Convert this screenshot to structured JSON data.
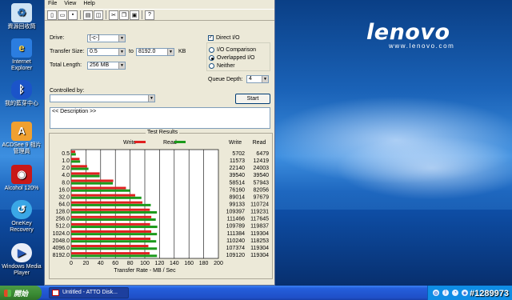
{
  "desktop": {
    "brand": "lenovo",
    "brand_url": "www.lenovo.com",
    "icons": [
      {
        "label": "資源回收筒",
        "icon": "recycle-bin-icon"
      },
      {
        "label": "Internet Explorer",
        "icon": "internet-explorer-icon"
      },
      {
        "label": "我的藍芽中心",
        "icon": "bluetooth-icon"
      },
      {
        "label": "ACDSee 9 相片管理員",
        "icon": "acdsee-icon"
      },
      {
        "label": "Alcohol 120%",
        "icon": "alcohol-icon"
      },
      {
        "label": "OneKey Recovery",
        "icon": "onekey-recovery-icon"
      },
      {
        "label": "Windows Media Player",
        "icon": "media-player-icon"
      }
    ]
  },
  "window": {
    "menu": [
      "File",
      "View",
      "Help"
    ],
    "drive_label": "Drive:",
    "drive_value": "[-c-]",
    "transfer_label": "Transfer Size:",
    "transfer_from": "0.5",
    "transfer_to_label": "to",
    "transfer_to": "8192.0",
    "transfer_unit": "KB",
    "length_label": "Total Length:",
    "length_value": "256 MB",
    "direct_io": "Direct I/O",
    "io_comparison": "I/O Comparison",
    "overlapped_io": "Overlapped I/O",
    "neither": "Neither",
    "queue_label": "Queue Depth:",
    "queue_value": "4",
    "controlled_by": "Controlled by:",
    "start_button": "Start",
    "description": "<< Description >>"
  },
  "chart_data": {
    "type": "bar",
    "title": "Test Results",
    "xlabel": "Transfer Rate - MB / Sec",
    "xlim": [
      0,
      200
    ],
    "x_ticks": [
      "0",
      "20",
      "40",
      "60",
      "80",
      "100",
      "120",
      "140",
      "160",
      "180",
      "200"
    ],
    "legend": [
      "Write",
      "Read"
    ],
    "column_headers": [
      "Write",
      "Read"
    ],
    "categories": [
      "0.5",
      "1.0",
      "2.0",
      "4.0",
      "8.0",
      "16.0",
      "32.0",
      "64.0",
      "128.0",
      "256.0",
      "512.0",
      "1024.0",
      "2048.0",
      "4096.0",
      "8192.0"
    ],
    "series": [
      {
        "name": "Write",
        "color": "#e02020",
        "values": [
          5702,
          11573,
          22140,
          39540,
          58514,
          76160,
          89014,
          99133,
          109397,
          111466,
          109789,
          111384,
          110240,
          107374,
          109120
        ]
      },
      {
        "name": "Read",
        "color": "#1a9a1a",
        "values": [
          6479,
          12419,
          24003,
          39540,
          57943,
          82056,
          97679,
          110724,
          119231,
          117645,
          119837,
          119304,
          118253,
          119304,
          119304
        ]
      }
    ]
  },
  "taskbar": {
    "start_label": "開始",
    "task_label": "Untitled - ATTO Disk...",
    "watermark": "#1289973"
  }
}
